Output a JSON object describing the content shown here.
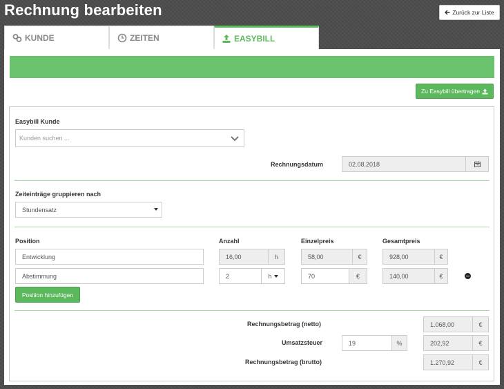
{
  "header": {
    "title": "Rechnung bearbeiten",
    "back_label": "Zurück zur Liste"
  },
  "tabs": [
    {
      "label": "KUNDE",
      "icon": "link-icon"
    },
    {
      "label": "ZEITEN",
      "icon": "clock-icon"
    },
    {
      "label": "EASYBILL",
      "icon": "upload-icon",
      "active": true
    }
  ],
  "toolbar": {
    "transfer_label": "Zu Easybill übertragen"
  },
  "customer": {
    "label": "Easybill Kunde",
    "placeholder": "Kunden suchen ..."
  },
  "invoice_date": {
    "label": "Rechnungsdatum",
    "value": "02.08.2018"
  },
  "grouping": {
    "label": "Zeiteinträge gruppieren nach",
    "value": "Stundensatz"
  },
  "positions": {
    "headers": {
      "position": "Position",
      "quantity": "Anzahl",
      "unit_price": "Einzelpreis",
      "total": "Gesamtpreis"
    },
    "rows": [
      {
        "name": "Entwicklung",
        "quantity": "16,00",
        "unit": "h",
        "unit_price": "58,00",
        "currency": "€",
        "total": "928,00",
        "total_currency": "€"
      },
      {
        "name": "Abstimmung",
        "quantity": "2",
        "unit": "h",
        "unit_price": "70",
        "currency": "€",
        "total": "140,00",
        "total_currency": "€"
      }
    ],
    "add_label": "Position hinzufügen"
  },
  "totals": {
    "net_label": "Rechnungsbetrag (netto)",
    "net_value": "1.068,00",
    "net_currency": "€",
    "vat_label": "Umsatzsteuer",
    "vat_rate": "19",
    "vat_percent": "%",
    "vat_value": "202,92",
    "vat_currency": "€",
    "gross_label": "Rechnungsbetrag (brutto)",
    "gross_value": "1.270,92",
    "gross_currency": "€"
  },
  "colors": {
    "accent": "#5cb85c",
    "banner": "#6cc36e",
    "background": "#4d4d4d"
  }
}
